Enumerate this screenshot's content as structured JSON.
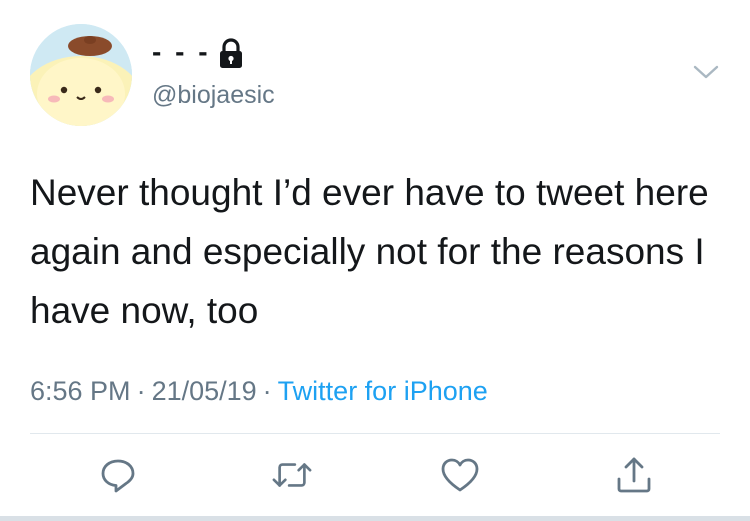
{
  "user": {
    "display_name": "- - -",
    "handle": "@biojaesic",
    "protected": true
  },
  "tweet": {
    "text": "Never thought I’d ever have to tweet here again and especially not for the reasons I have now, too",
    "time": "6:56 PM",
    "separator": "·",
    "date": "21/05/19",
    "source": "Twitter for iPhone"
  },
  "icons": {
    "lock": "lock-icon",
    "menu": "chevron-down-icon",
    "reply": "reply-icon",
    "retweet": "retweet-icon",
    "like": "heart-icon",
    "share": "share-icon"
  },
  "colors": {
    "text": "#14171a",
    "secondary": "#657786",
    "link": "#1da1f2",
    "divider": "#e1e8ed"
  }
}
